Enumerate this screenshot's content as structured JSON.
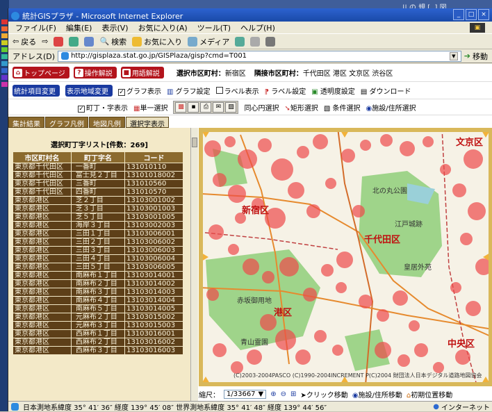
{
  "desktop": {
    "top_right_text": "|| の 規 [..] 図"
  },
  "window": {
    "title": "統計GISプラザ - Microsoft Internet Explorer",
    "controls": [
      "_",
      "□",
      "×"
    ]
  },
  "menu": [
    "ファイル(F)",
    "編集(E)",
    "表示(V)",
    "お気に入り(A)",
    "ツール(T)",
    "ヘルプ(H)"
  ],
  "toolbar": {
    "back": "戻る",
    "search": "検索",
    "favorites": "お気に入り",
    "media": "メディア"
  },
  "address": {
    "label": "アドレス(D)",
    "url": "http://gisplaza.stat.go.jp/GISPlaza/gisp?cmd=T001",
    "go": "移動"
  },
  "nav": {
    "top_page": "トップページ",
    "manual": "操作解説",
    "glossary": "用語解説",
    "selected_label": "選択市区町村：",
    "selected_value": "新宿区",
    "adjacent_label": "隣接市区町村：",
    "adjacent_value": "千代田区 港区 文京区 渋谷区"
  },
  "controls": {
    "stat_change": "統計項目変更",
    "area_change": "表示地域変更",
    "graph_show": "グラフ表示",
    "graph_setting": "グラフ設定",
    "label_show": "ラベル表示",
    "label_setting": "ラベル設定",
    "transparency": "透明度設定",
    "download": "ダウンロード"
  },
  "tools_row": {
    "town_show": "町丁・字表示",
    "single_select": "単一選択",
    "concentric": "同心円選択",
    "rect_select": "矩形選択",
    "condition_select": "条件選択",
    "facility_select": "施設/住所選択"
  },
  "tabs": [
    {
      "label": "集計結果",
      "active": false
    },
    {
      "label": "グラフ凡例",
      "active": false
    },
    {
      "label": "地図凡例",
      "active": false
    },
    {
      "label": "選択字表示",
      "active": true
    }
  ],
  "list": {
    "title": "選択町丁字リスト[件数：269]",
    "headers": [
      "市区町村名",
      "町丁字名",
      "コード"
    ],
    "rows": [
      [
        "東京都千代田区",
        "一番町",
        "131010110"
      ],
      [
        "東京都千代田区",
        "富士見２丁目",
        "13101018002"
      ],
      [
        "東京都千代田区",
        "三番町",
        "131010560"
      ],
      [
        "東京都千代田区",
        "四番町",
        "131010570"
      ],
      [
        "東京都港区",
        "芝２丁目",
        "13103001002"
      ],
      [
        "東京都港区",
        "芝３丁目",
        "13103001003"
      ],
      [
        "東京都港区",
        "芝５丁目",
        "13103001005"
      ],
      [
        "東京都港区",
        "海岸３丁目",
        "13103002003"
      ],
      [
        "東京都港区",
        "三田１丁目",
        "13103006001"
      ],
      [
        "東京都港区",
        "三田２丁目",
        "13103006002"
      ],
      [
        "東京都港区",
        "三田３丁目",
        "13103006003"
      ],
      [
        "東京都港区",
        "三田４丁目",
        "13103006004"
      ],
      [
        "東京都港区",
        "三田５丁目",
        "13103006005"
      ],
      [
        "東京都港区",
        "南麻布１丁目",
        "13103014001"
      ],
      [
        "東京都港区",
        "南麻布２丁目",
        "13103014002"
      ],
      [
        "東京都港区",
        "南麻布３丁目",
        "13103014003"
      ],
      [
        "東京都港区",
        "南麻布４丁目",
        "13103014004"
      ],
      [
        "東京都港区",
        "南麻布５丁目",
        "13103014005"
      ],
      [
        "東京都港区",
        "元麻布２丁目",
        "13103015002"
      ],
      [
        "東京都港区",
        "元麻布３丁目",
        "13103015003"
      ],
      [
        "東京都港区",
        "西麻布１丁目",
        "13103016001"
      ],
      [
        "東京都港区",
        "西麻布２丁目",
        "13103016002"
      ],
      [
        "東京都港区",
        "西麻布３丁目",
        "13103016003"
      ]
    ]
  },
  "map": {
    "labels": {
      "shinjuku": "新宿区",
      "chiyoda": "千代田区",
      "minato": "港区",
      "chuo": "中央区",
      "bunkyo": "文京区",
      "edo": "江戸城跡",
      "kitanomaru": "北の丸公園",
      "kokyo": "皇居外苑",
      "akasaka": "赤坂御用地",
      "aoyama": "青山霊園"
    },
    "copyright": "(C)2003-2004PASCO (C)1990-2004INCREMENT P(C)2004 財団法人日本デジタル道路地図協会"
  },
  "scale": {
    "label": "縮尺：",
    "value": "1/33667",
    "click_move": "クリック移動",
    "facility_move": "施設/住所移動",
    "initial_move": "初期位置移動"
  },
  "status": {
    "coords": "日本測地系緯度 35° 41′ 36″  経度 139° 45′ 08″  世界測地系緯度 35° 41′ 48″  経度 139° 44′ 56″",
    "zone": "インターネット"
  },
  "colors": {
    "bubble": "#ee4a4a",
    "park": "#9fd48a",
    "panel": "#f3e9c8",
    "table_dark": "#5d3f18",
    "frame": "#d9b85a"
  }
}
